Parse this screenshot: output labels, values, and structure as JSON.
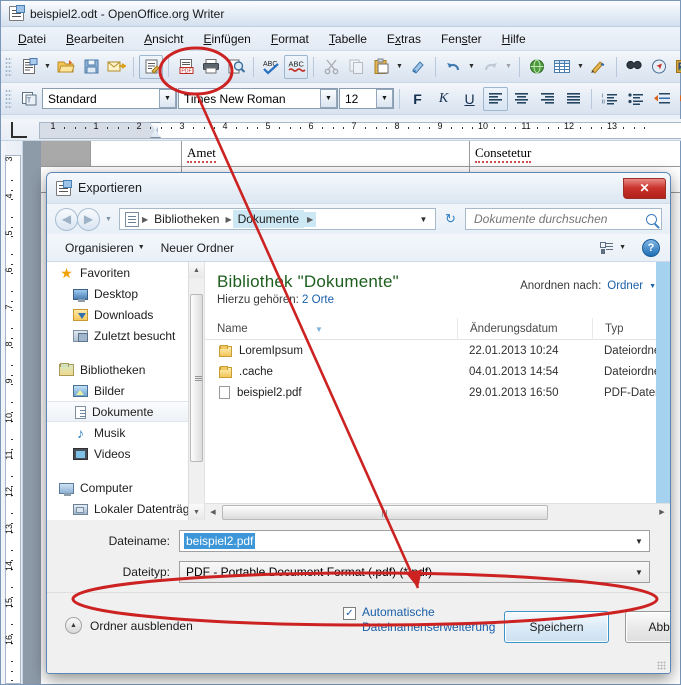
{
  "writer": {
    "title": "beispiel2.odt - OpenOffice.org Writer",
    "app_icon": "writer-document-icon",
    "menu": [
      {
        "label": "Datei",
        "mnemonic": "D"
      },
      {
        "label": "Bearbeiten",
        "mnemonic": "B"
      },
      {
        "label": "Ansicht",
        "mnemonic": "A"
      },
      {
        "label": "Einfügen",
        "mnemonic": "E"
      },
      {
        "label": "Format",
        "mnemonic": "F"
      },
      {
        "label": "Tabelle",
        "mnemonic": "T"
      },
      {
        "label": "Extras",
        "mnemonic": "x"
      },
      {
        "label": "Fenster",
        "mnemonic": "s"
      },
      {
        "label": "Hilfe",
        "mnemonic": "H"
      }
    ],
    "standard_toolbar": [
      {
        "name": "new-document-icon",
        "glyph": "☰"
      },
      {
        "name": "new-document-dropdown-arrow-icon",
        "glyph": "▼"
      },
      {
        "name": "open-folder-icon",
        "glyph": "☰"
      },
      {
        "name": "save-icon",
        "glyph": "☰"
      },
      {
        "name": "send-email-icon",
        "glyph": "✉"
      },
      {
        "name": "edit-file-icon",
        "glyph": "☰"
      },
      {
        "name": "export-as-pdf-icon",
        "glyph": "PDF"
      },
      {
        "name": "print-icon",
        "glyph": "☰"
      },
      {
        "name": "print-preview-icon",
        "glyph": "⌕"
      },
      {
        "name": "spelling-autocheck-icon",
        "glyph": "ABC"
      },
      {
        "name": "spelling-check-icon",
        "glyph": "ABC"
      },
      {
        "name": "cut-icon",
        "glyph": "✂"
      },
      {
        "name": "copy-icon",
        "glyph": "❐"
      },
      {
        "name": "paste-icon",
        "glyph": "☰"
      },
      {
        "name": "paste-dropdown-arrow-icon",
        "glyph": "▼"
      },
      {
        "name": "clone-formatting-icon",
        "glyph": "✒"
      },
      {
        "name": "undo-icon",
        "glyph": "↶"
      },
      {
        "name": "undo-dropdown-arrow-icon",
        "glyph": "▼"
      },
      {
        "name": "redo-icon",
        "glyph": "↷"
      },
      {
        "name": "redo-dropdown-arrow-icon",
        "glyph": "▼"
      },
      {
        "name": "hyperlink-icon",
        "glyph": "ἱ0"
      },
      {
        "name": "insert-table-icon",
        "glyph": "▦"
      },
      {
        "name": "insert-table-dropdown-arrow-icon",
        "glyph": "▼"
      },
      {
        "name": "show-draw-functions-icon",
        "glyph": "✎"
      },
      {
        "name": "find-and-replace-icon",
        "glyph": "⌕"
      },
      {
        "name": "navigator-icon",
        "glyph": "⦿"
      },
      {
        "name": "gallery-icon",
        "glyph": "⬛"
      }
    ],
    "format_toolbar": {
      "paragraph_style_icon": "apply-style-icon",
      "paragraph_style": "Standard",
      "font_name": "Times New Roman",
      "font_size": "12",
      "bold_label": "F",
      "italic_label": "K",
      "underline_label": "U",
      "align_left_icon": "align-left-icon",
      "align_center_icon": "align-center-icon",
      "align_right_icon": "align-right-icon",
      "align_justify_icon": "align-justify-icon",
      "ordered_list_icon": "numbered-list-icon",
      "unordered_list_icon": "bulleted-list-icon",
      "decrease_indent_icon": "decrease-indent-icon",
      "increase_indent_icon": "increase-indent-icon"
    },
    "ruler": {
      "horizontal_ticks": [
        "1",
        "1",
        "2",
        "3",
        "4",
        "5",
        "6",
        "7",
        "8",
        "9",
        "10",
        "11",
        "12",
        "13"
      ],
      "vertical_ticks": [
        "3",
        "4",
        "5",
        "6",
        "7",
        "8",
        "9",
        "10",
        "11",
        "12",
        "13",
        "14",
        "15",
        "16"
      ]
    },
    "document": {
      "cell_1": "Amet",
      "cell_2": "Consetetur"
    }
  },
  "dialog": {
    "title": "Exportieren",
    "title_icon": "export-document-icon",
    "close_label": "✕",
    "nav": {
      "back_icon": "back-arrow-icon",
      "forward_icon": "forward-arrow-icon",
      "history_dropdown_icon": "chevron-down-icon",
      "breadcrumb_icon": "library-icon",
      "crumbs": [
        "Bibliotheken",
        "Dokumente"
      ],
      "crumb_dropdown_icon": "chevron-down-icon",
      "refresh_icon": "refresh-icon",
      "search_placeholder": "Dokumente durchsuchen",
      "search_value": "",
      "search_icon": "search-icon"
    },
    "toolbar": {
      "organize_label": "Organisieren",
      "organize_caret_icon": "chevron-down-icon",
      "new_folder_label": "Neuer Ordner",
      "view_icon": "view-layout-icon",
      "view_caret_icon": "chevron-down-icon",
      "help_icon": "help-icon",
      "help_label": "?"
    },
    "nav_pane": {
      "groups": [
        {
          "header": {
            "label": "Favoriten",
            "icon": "star-icon"
          },
          "items": [
            {
              "label": "Desktop",
              "icon": "desktop-icon"
            },
            {
              "label": "Downloads",
              "icon": "downloads-folder-icon"
            },
            {
              "label": "Zuletzt besucht",
              "icon": "recent-places-icon"
            }
          ]
        },
        {
          "header": {
            "label": "Bibliotheken",
            "icon": "libraries-icon"
          },
          "items": [
            {
              "label": "Bilder",
              "icon": "pictures-library-icon"
            },
            {
              "label": "Dokumente",
              "icon": "documents-library-icon",
              "selected": true
            },
            {
              "label": "Musik",
              "icon": "music-library-icon"
            },
            {
              "label": "Videos",
              "icon": "videos-library-icon"
            }
          ]
        },
        {
          "header": {
            "label": "Computer",
            "icon": "computer-icon"
          },
          "items": [
            {
              "label": "Lokaler Datenträg",
              "icon": "local-disk-icon"
            }
          ]
        }
      ],
      "scrollbar_up_icon": "scroll-up-arrow-icon",
      "scrollbar_down_icon": "scroll-down-arrow-icon"
    },
    "list_pane": {
      "library_title": "Bibliothek \"Dokumente\"",
      "includes_label": "Hierzu gehören:",
      "includes_value": "2 Orte",
      "arrange_label": "Anordnen nach:",
      "arrange_value": "Ordner",
      "arrange_caret_icon": "chevron-down-icon",
      "columns": [
        "Name",
        "Änderungsdatum",
        "Typ"
      ],
      "sort_indicator_icon": "sort-ascending-icon",
      "rows": [
        {
          "name": "LoremIpsum",
          "icon": "folder-icon",
          "date": "22.01.2013 10:24",
          "type": "Dateiordner"
        },
        {
          "name": ".cache",
          "icon": "folder-icon",
          "date": "04.01.2013 14:54",
          "type": "Dateiordner"
        },
        {
          "name": "beispiel2.pdf",
          "icon": "pdf-file-icon",
          "date": "29.01.2013 16:50",
          "type": "PDF-Datei"
        }
      ],
      "hscroll_left_icon": "scroll-left-arrow-icon",
      "hscroll_right_icon": "scroll-right-arrow-icon"
    },
    "form": {
      "filename_label": "Dateiname:",
      "filename_value": "beispiel2.pdf",
      "filename_caret_icon": "chevron-down-icon",
      "filetype_label": "Dateityp:",
      "filetype_value": "PDF - Portable Document Format (.pdf) (*.pdf)",
      "filetype_caret_icon": "chevron-down-icon"
    },
    "footer": {
      "hide_folders_label": "Ordner ausblenden",
      "hide_folders_icon": "collapse-up-icon",
      "auto_ext_line1": "Automatische",
      "auto_ext_line2": "Dateinamenserweiterung",
      "auto_ext_checked": true,
      "auto_ext_check_glyph": "✓",
      "save_label": "Speichern",
      "cancel_label": "Abbrechen",
      "resize_grip_icon": "resize-grip-icon"
    }
  },
  "annotations": {
    "color": "#cc2222",
    "ellipse_toolbar_name": "pdf-export-toolbar-highlight",
    "ellipse_filetype_name": "filetype-row-highlight",
    "arrow_name": "pointer-arrow"
  }
}
